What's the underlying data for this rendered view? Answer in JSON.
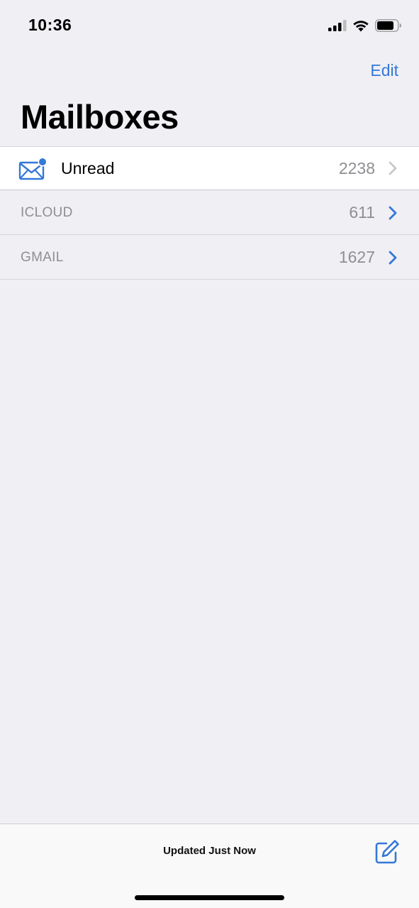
{
  "status_bar": {
    "time": "10:36",
    "icons": [
      "cellular-signal-icon",
      "wifi-icon",
      "battery-icon"
    ]
  },
  "nav": {
    "edit_label": "Edit",
    "title": "Mailboxes"
  },
  "mailboxes": [
    {
      "label": "Unread",
      "count": "2238",
      "icon": "envelope-badge-icon"
    }
  ],
  "accounts": [
    {
      "label": "ICLOUD",
      "count": "611"
    },
    {
      "label": "GMAIL",
      "count": "1627"
    }
  ],
  "toolbar": {
    "status_text": "Updated Just Now",
    "compose_icon": "compose-icon"
  },
  "colors": {
    "accent": "#3478d8",
    "background": "#efeff4",
    "secondary_text": "#8e8e93"
  }
}
